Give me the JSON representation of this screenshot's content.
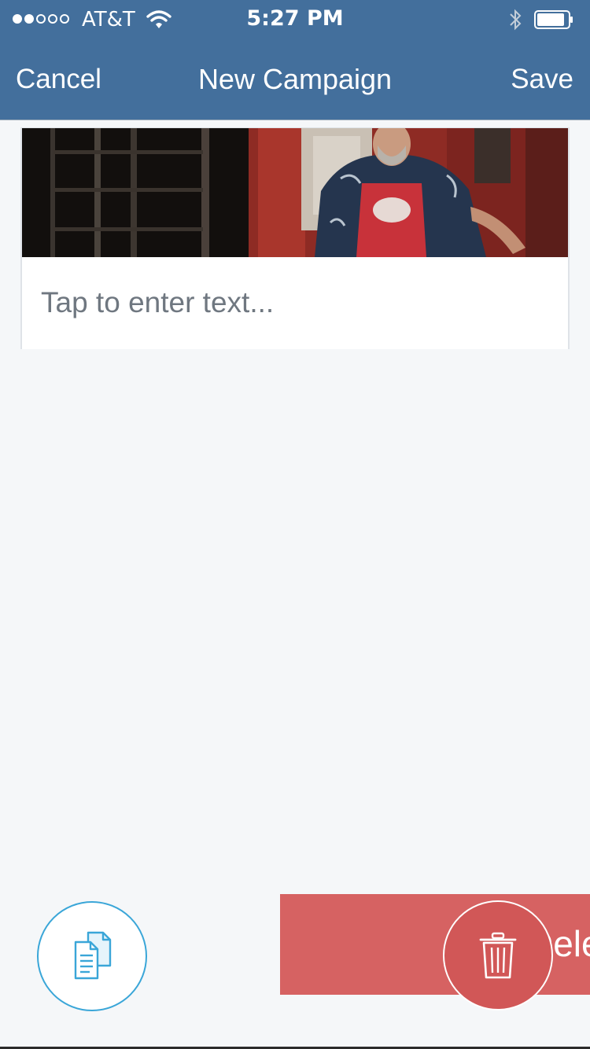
{
  "status_bar": {
    "carrier": "AT&T",
    "time": "5:27 PM",
    "signal_bars_filled": 2,
    "signal_bars_total": 5,
    "icons": [
      "wifi-icon",
      "bluetooth-icon",
      "battery-icon"
    ]
  },
  "nav": {
    "cancel_label": "Cancel",
    "title": "New Campaign",
    "save_label": "Save"
  },
  "card": {
    "text_placeholder": "Tap to enter text..."
  },
  "actions": {
    "copy_icon": "copy-documents-icon",
    "delete_label": "Delete",
    "trash_icon": "trash-icon"
  },
  "colors": {
    "header": "#436f9c",
    "background": "#f5f7f9",
    "accent_blue": "#3aa6d8",
    "delete_red": "#d66262"
  }
}
